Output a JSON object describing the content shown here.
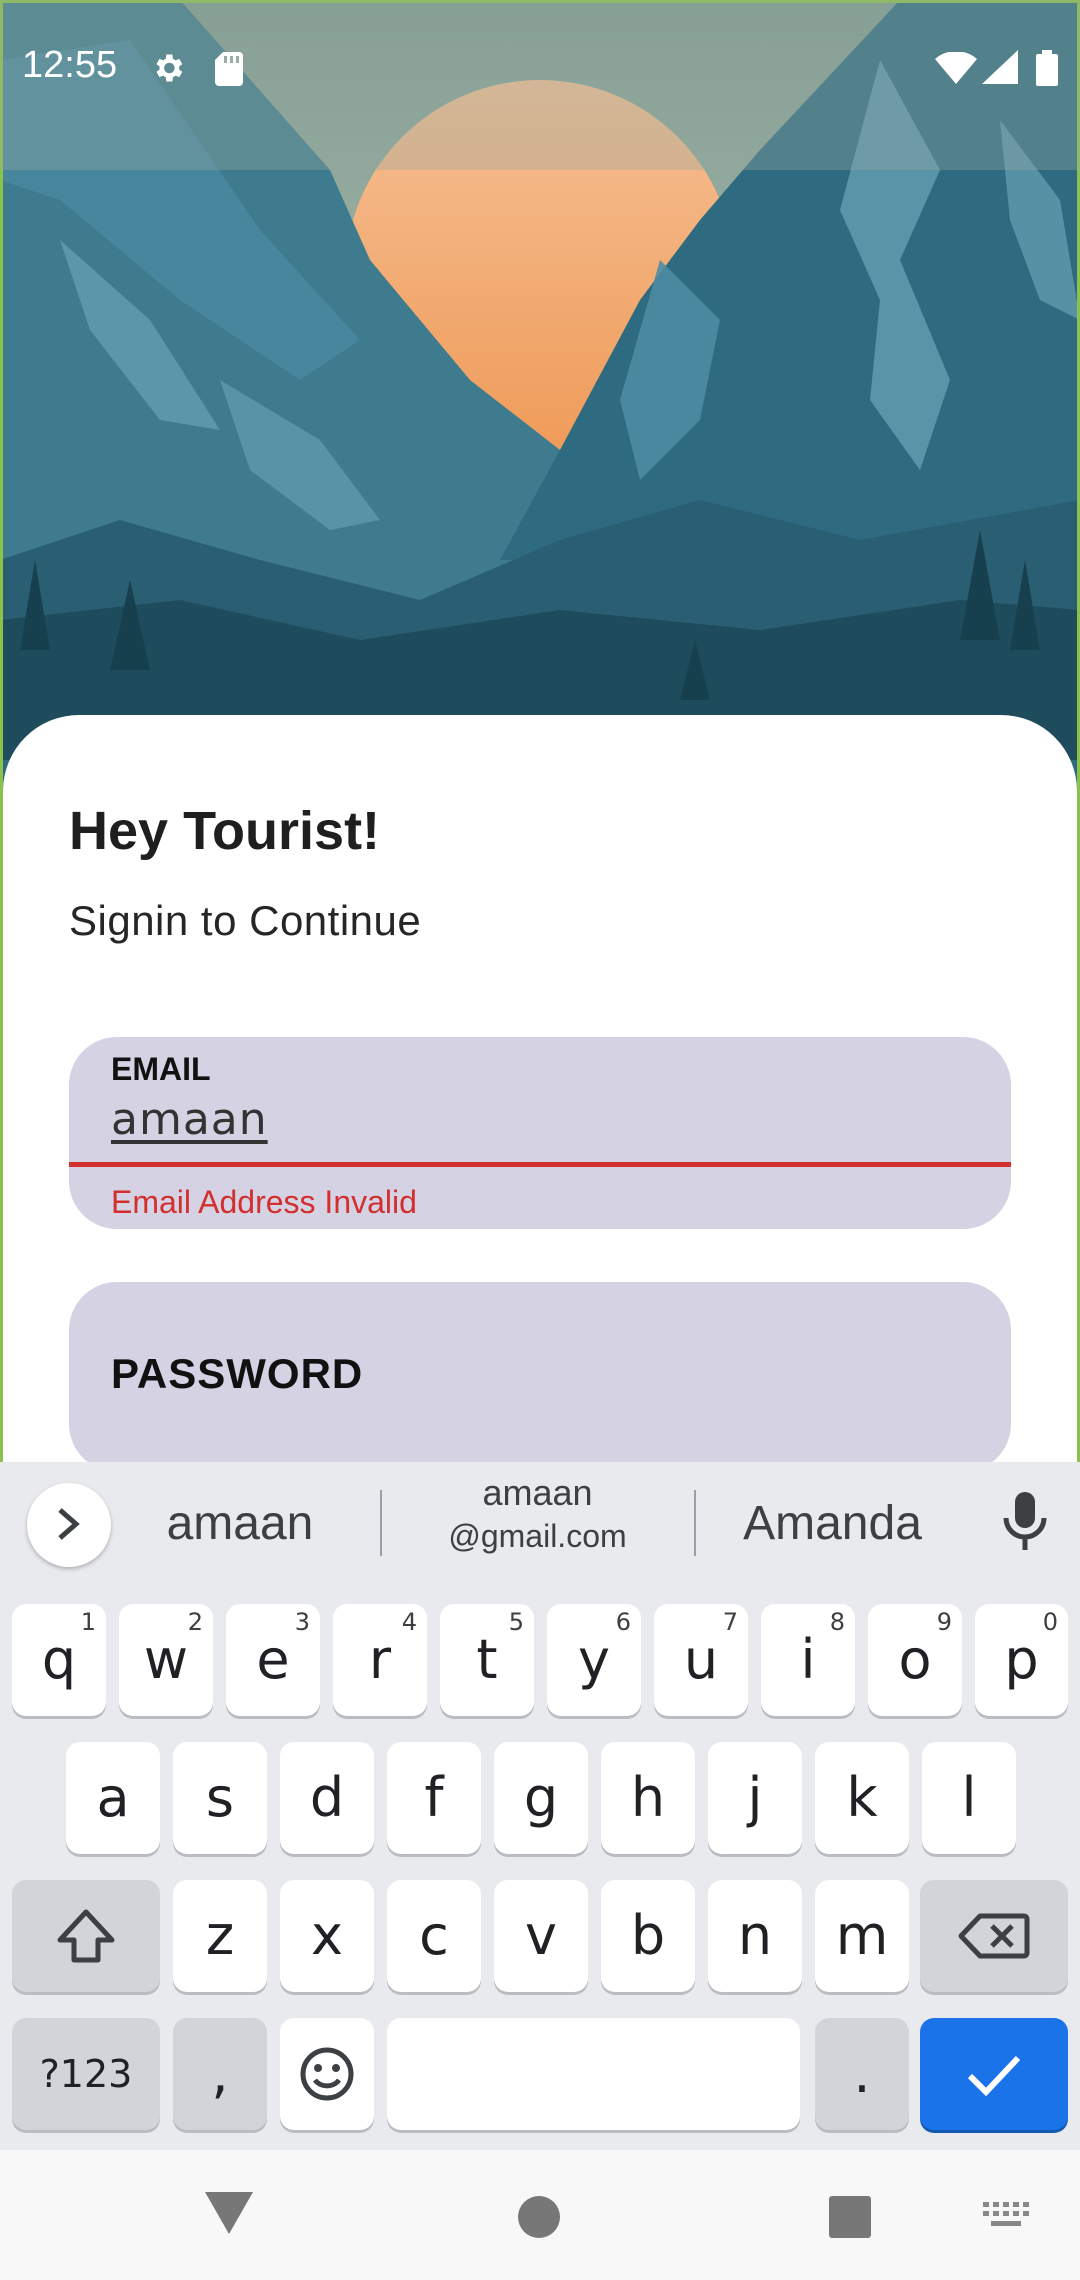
{
  "status_bar": {
    "time": "12:55",
    "icons": [
      "gear-icon",
      "sd-card-icon",
      "wifi-icon",
      "signal-icon",
      "battery-icon"
    ]
  },
  "login": {
    "title": "Hey Tourist!",
    "subtitle": "Signin to Continue",
    "email": {
      "label": "EMAIL",
      "value": "amaan",
      "error": "Email Address Invalid"
    },
    "password": {
      "label": "PASSWORD",
      "value": ""
    }
  },
  "keyboard": {
    "suggestions": {
      "left": "amaan",
      "center_line1": "amaan",
      "center_line2": "@gmail.com",
      "right": "Amanda"
    },
    "row1": [
      {
        "key": "q",
        "hint": "1"
      },
      {
        "key": "w",
        "hint": "2"
      },
      {
        "key": "e",
        "hint": "3"
      },
      {
        "key": "r",
        "hint": "4"
      },
      {
        "key": "t",
        "hint": "5"
      },
      {
        "key": "y",
        "hint": "6"
      },
      {
        "key": "u",
        "hint": "7"
      },
      {
        "key": "i",
        "hint": "8"
      },
      {
        "key": "o",
        "hint": "9"
      },
      {
        "key": "p",
        "hint": "0"
      }
    ],
    "row2": [
      "a",
      "s",
      "d",
      "f",
      "g",
      "h",
      "j",
      "k",
      "l"
    ],
    "row3": [
      "z",
      "x",
      "c",
      "v",
      "b",
      "n",
      "m"
    ],
    "row4": {
      "symbols": "?123",
      "comma": ",",
      "period": "."
    }
  },
  "colors": {
    "accent": "#1a73e8",
    "error": "#d32f2f",
    "field_bg": "#d4d2e3",
    "frame": "#8bc34a"
  }
}
